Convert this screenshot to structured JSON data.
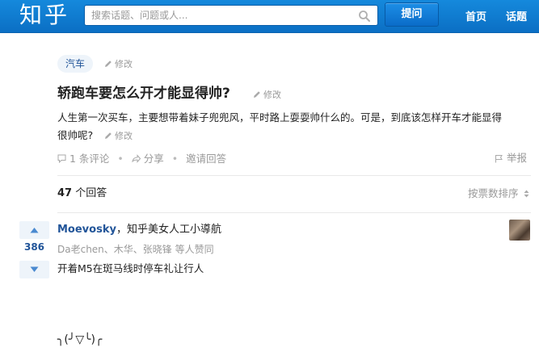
{
  "header": {
    "logo": "知乎",
    "search_placeholder": "搜索话题、问题或人...",
    "ask_label": "提问",
    "nav": [
      "首页",
      "话题"
    ],
    "brand_color": "#0b76d1"
  },
  "question": {
    "topic": "汽车",
    "edit_label": "修改",
    "title": "轿跑车要怎么开才能显得帅?",
    "detail_line1": "人生第一次买车，主要想带着妹子兜兜风，平时路上耍耍帅什么的。可是，到底该怎样开车才能显得",
    "detail_line2": "很帅呢?",
    "comments": "1 条评论",
    "share": "分享",
    "invite": "邀请回答",
    "report": "举报"
  },
  "answers_header": {
    "count": "47",
    "count_suffix": "个回答",
    "sort_label": "按票数排序"
  },
  "answer": {
    "votes": "386",
    "author": "Moevosky",
    "author_bio": "，知乎美女人工小導航",
    "voters": "Da老chen、木华、张晓锋 等人赞同",
    "text": "开着M5在斑马线时停车礼让行人",
    "kaomoji": "╮(╯▽╰)╭"
  }
}
